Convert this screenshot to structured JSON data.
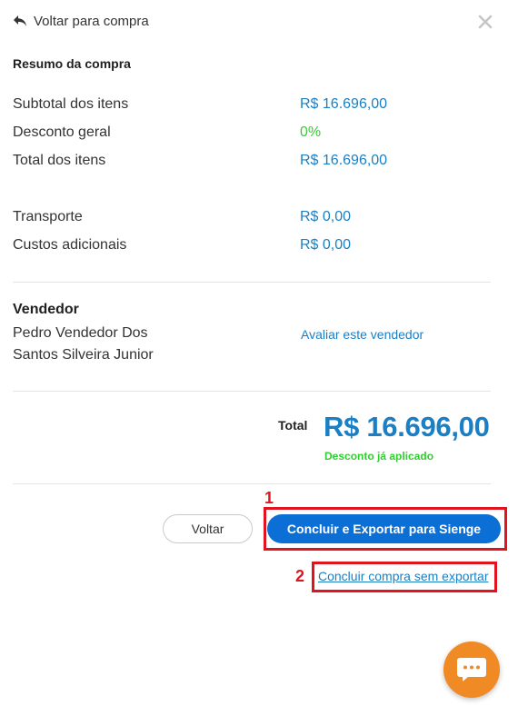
{
  "header": {
    "back_label": "Voltar para compra",
    "back_icon": "reply-arrow-icon",
    "close_icon": "close-icon"
  },
  "summary": {
    "title": "Resumo da compra",
    "rows": [
      {
        "label": "Subtotal dos itens",
        "value": "R$ 16.696,00"
      },
      {
        "label": "Desconto geral",
        "value": "0%"
      },
      {
        "label": "Total dos itens",
        "value": "R$ 16.696,00"
      },
      {
        "label": "Transporte",
        "value": "R$ 0,00"
      },
      {
        "label": "Custos adicionais",
        "value": "R$ 0,00"
      }
    ]
  },
  "vendor": {
    "title": "Vendedor",
    "name": "Pedro Vendedor Dos Santos Silveira Junior",
    "rate_link": "Avaliar este vendedor"
  },
  "total": {
    "label": "Total",
    "value": "R$ 16.696,00",
    "note": "Desconto já aplicado"
  },
  "actions": {
    "back_button": "Voltar",
    "export_button": "Concluir e Exportar para Sienge",
    "no_export_link": "Concluir compra sem exportar"
  },
  "annotations": {
    "marker_1": "1",
    "marker_2": "2"
  },
  "chat": {
    "icon": "chat-bubble-icon"
  },
  "colors": {
    "link_blue": "#1a7fc4",
    "primary_button": "#0b6fd6",
    "success_green": "#2fcf2f",
    "annotation_red": "#e0141e",
    "chat_orange": "#f08a24"
  }
}
